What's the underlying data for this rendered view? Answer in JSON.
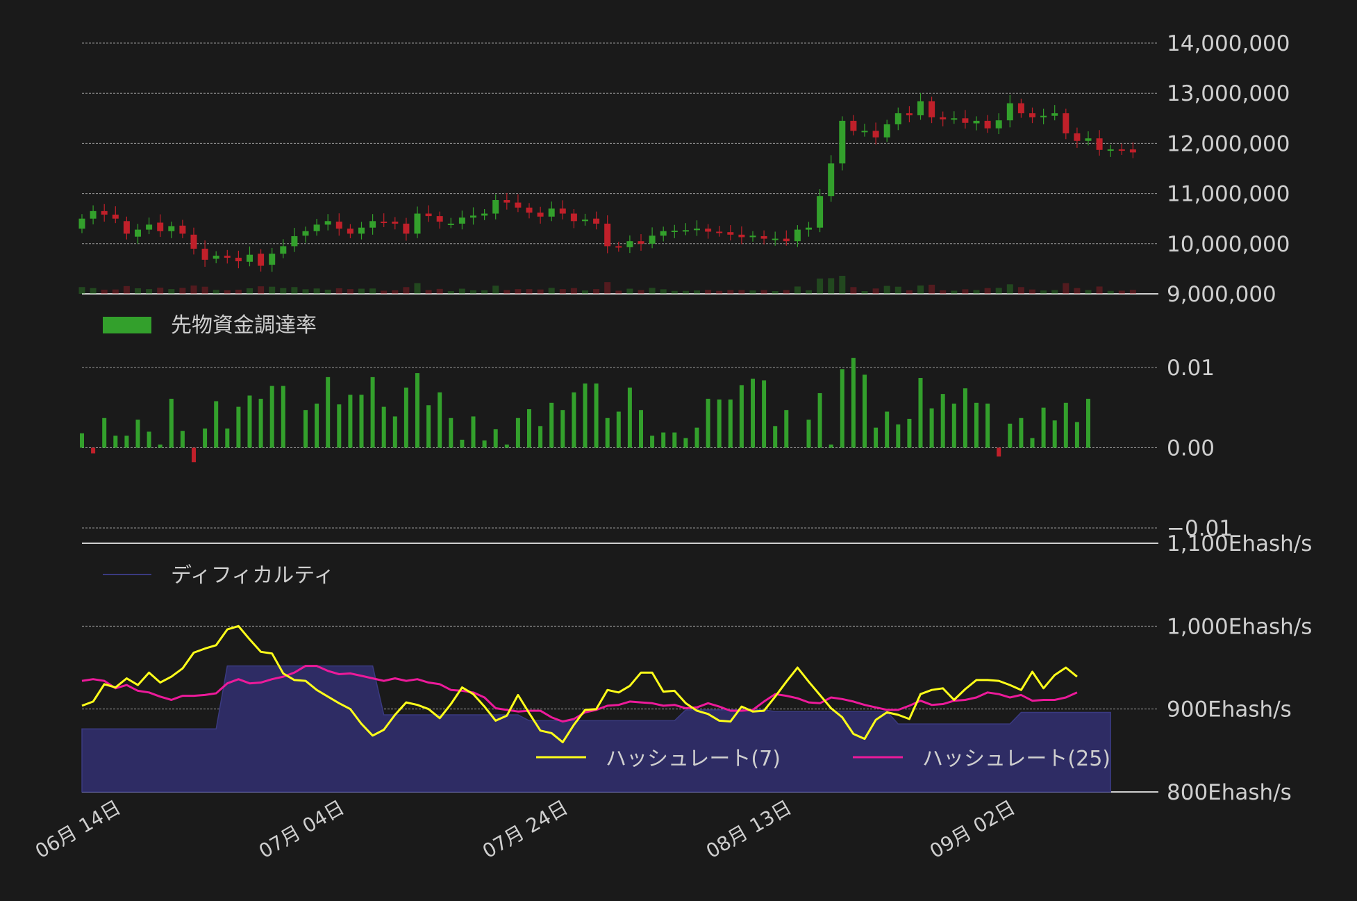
{
  "colors": {
    "background": "#1a1a1a",
    "up": "#33a02c",
    "down": "#c0202a",
    "funding_bar": "#33a02c",
    "difficulty_fill": "#2e2c64",
    "difficulty_line": "#3a3a80",
    "hashrate7": "#ffff1a",
    "hashrate25": "#ec1a9a",
    "axis_text": "#cfcfcf",
    "grid": "#9a9a9a"
  },
  "chart_data": [
    {
      "type": "candlestick",
      "panel": "price",
      "ylim": [
        9000000,
        14000000
      ],
      "y_ticks": [
        "14,000,000",
        "13,000,000",
        "12,000,000",
        "11,000,000",
        "10,000,000",
        "9,000,000"
      ],
      "y_tick_values": [
        14000000,
        13000000,
        12000000,
        11000000,
        10000000,
        9000000
      ],
      "x_tick_labels": [
        "06月 14日",
        "07月 04日",
        "07月 24日",
        "08月 13日",
        "09月 02日"
      ],
      "x_tick_index": [
        0,
        20,
        40,
        60,
        80
      ],
      "close": [
        10500000,
        10650000,
        10580000,
        10500000,
        10200000,
        10280000,
        10380000,
        10250000,
        10350000,
        10200000,
        9900000,
        9680000,
        9760000,
        9720000,
        9650000,
        9780000,
        9560000,
        9800000,
        9950000,
        10150000,
        10250000,
        10380000,
        10450000,
        10300000,
        10200000,
        10320000,
        10450000,
        10420000,
        10400000,
        10200000,
        10600000,
        10550000,
        10440000,
        10400000,
        10520000,
        10560000,
        10600000,
        10870000,
        10820000,
        10720000,
        10620000,
        10540000,
        10700000,
        10600000,
        10450000,
        10480000,
        10400000,
        9950000,
        9930000,
        10050000,
        10000000,
        10160000,
        10250000,
        10260000,
        10270000,
        10300000,
        10240000,
        10230000,
        10180000,
        10130000,
        10160000,
        10100000,
        10100000,
        10050000,
        10280000,
        10320000,
        10950000,
        11600000,
        12450000,
        12250000,
        12250000,
        12120000,
        12380000,
        12600000,
        12560000,
        12840000,
        12520000,
        12480000,
        12500000,
        12410000,
        12450000,
        12300000,
        12460000,
        12800000,
        12600000,
        12520000,
        12550000,
        12600000,
        12200000,
        12050000,
        12100000,
        11870000,
        11880000,
        11860000,
        11820000
      ],
      "open": [
        10300000,
        10500000,
        10650000,
        10580000,
        10450000,
        10140000,
        10280000,
        10420000,
        10250000,
        10360000,
        10180000,
        9900000,
        9700000,
        9760000,
        9720000,
        9640000,
        9800000,
        9580000,
        9800000,
        9950000,
        10160000,
        10250000,
        10380000,
        10440000,
        10300000,
        10200000,
        10320000,
        10440000,
        10440000,
        10400000,
        10200000,
        10600000,
        10550000,
        10400000,
        10400000,
        10520000,
        10560000,
        10600000,
        10870000,
        10820000,
        10720000,
        10620000,
        10540000,
        10700000,
        10600000,
        10450000,
        10500000,
        10400000,
        9950000,
        9930000,
        10050000,
        10000000,
        10160000,
        10250000,
        10260000,
        10270000,
        10300000,
        10240000,
        10230000,
        10180000,
        10130000,
        10150000,
        10100000,
        10100000,
        10050000,
        10280000,
        10320000,
        10950000,
        11600000,
        12450000,
        12250000,
        12250000,
        12120000,
        12380000,
        12600000,
        12560000,
        12840000,
        12520000,
        12480000,
        12500000,
        12400000,
        12450000,
        12300000,
        12460000,
        12800000,
        12600000,
        12520000,
        12550000,
        12600000,
        12200000,
        12050000,
        12100000,
        11870000,
        11880000,
        11880000
      ]
    },
    {
      "type": "bar",
      "panel": "funding",
      "series": [
        {
          "name": "先物資金調達率"
        }
      ],
      "ylim": [
        -0.01,
        0.01
      ],
      "y_ticks": [
        "0.01",
        "0.00",
        "−0.01"
      ],
      "y_tick_values": [
        0.01,
        0.0,
        -0.01
      ],
      "values": [
        0.0018,
        -0.0007,
        0.0037,
        0.0015,
        0.0015,
        0.0035,
        0.002,
        0.0004,
        0.0061,
        0.0021,
        -0.0018,
        0.0024,
        0.0058,
        0.0024,
        0.0051,
        0.0065,
        0.0061,
        0.0077,
        0.0077,
        null,
        0.0047,
        0.0055,
        0.0088,
        0.0054,
        0.0066,
        0.0066,
        0.0088,
        0.0051,
        0.0039,
        0.0075,
        0.0093,
        0.0053,
        0.0069,
        0.0037,
        0.001,
        0.0039,
        0.0009,
        0.0023,
        0.0004,
        0.0037,
        0.0048,
        0.0027,
        0.0056,
        0.0047,
        0.0069,
        0.008,
        0.008,
        0.0037,
        0.0045,
        0.0075,
        0.0047,
        0.0015,
        0.0019,
        0.0019,
        0.0012,
        0.0025,
        0.0061,
        0.006,
        0.006,
        0.0078,
        0.0086,
        0.0084,
        0.0027,
        0.0047,
        null,
        0.0035,
        0.0068,
        0.0004,
        0.0098,
        0.0112,
        0.0091,
        0.0025,
        0.0045,
        0.0029,
        0.0036,
        0.0087,
        0.0049,
        0.0067,
        0.0055,
        0.0074,
        0.0056,
        0.0055,
        -0.0011,
        0.003,
        0.0037,
        0.0012,
        0.005,
        0.0034,
        0.0056,
        0.0032,
        0.0061
      ]
    },
    {
      "type": "line",
      "panel": "hashrate",
      "ylim": [
        800,
        1100
      ],
      "y_ticks": [
        "1,100Ehash/s",
        "1,000Ehash/s",
        "900Ehash/s",
        "800Ehash/s"
      ],
      "y_tick_values": [
        1100,
        1000,
        900,
        800
      ],
      "series": [
        {
          "name": "ディフィカルティ",
          "type": "area",
          "values": [
            876,
            876,
            876,
            876,
            876,
            876,
            876,
            876,
            876,
            876,
            876,
            876,
            876,
            952,
            952,
            952,
            952,
            952,
            952,
            952,
            952,
            952,
            952,
            952,
            952,
            952,
            952,
            893,
            893,
            893,
            893,
            893,
            893,
            893,
            893,
            893,
            893,
            893,
            893,
            893,
            886,
            886,
            886,
            886,
            886,
            886,
            886,
            886,
            886,
            886,
            886,
            886,
            886,
            886,
            899,
            899,
            899,
            899,
            899,
            899,
            899,
            899,
            897,
            897,
            897,
            897,
            897,
            897,
            897,
            897,
            897,
            897,
            897,
            882,
            882,
            882,
            882,
            882,
            882,
            882,
            882,
            882,
            882,
            882,
            896,
            896,
            896,
            896,
            896,
            896,
            896,
            896,
            896
          ]
        },
        {
          "name": "ハッシュレート(7)",
          "values": [
            904,
            909,
            930,
            926,
            937,
            929,
            944,
            932,
            939,
            949,
            968,
            973,
            977,
            996,
            1000,
            984,
            969,
            967,
            943,
            935,
            934,
            923,
            915,
            907,
            900,
            882,
            868,
            875,
            893,
            908,
            905,
            900,
            889,
            906,
            926,
            918,
            903,
            886,
            892,
            917,
            895,
            874,
            871,
            860,
            881,
            899,
            900,
            923,
            920,
            928,
            944,
            944,
            921,
            922,
            907,
            898,
            894,
            886,
            885,
            903,
            897,
            898,
            915,
            933,
            950,
            933,
            917,
            901,
            890,
            870,
            864,
            887,
            896,
            893,
            888,
            918,
            923,
            925,
            911,
            924,
            935,
            935,
            934,
            929,
            923,
            945,
            925,
            941,
            950,
            939
          ]
        },
        {
          "name": "ハッシュレート(25)",
          "values": [
            934,
            936,
            934,
            925,
            929,
            922,
            920,
            915,
            911,
            916,
            916,
            917,
            919,
            931,
            936,
            931,
            932,
            936,
            939,
            944,
            952,
            952,
            946,
            942,
            943,
            940,
            937,
            934,
            937,
            934,
            936,
            932,
            930,
            923,
            922,
            920,
            914,
            901,
            899,
            897,
            898,
            898,
            890,
            885,
            888,
            896,
            899,
            904,
            905,
            909,
            908,
            907,
            904,
            905,
            901,
            902,
            907,
            903,
            898,
            898,
            899,
            909,
            918,
            916,
            913,
            908,
            907,
            914,
            912,
            909,
            905,
            902,
            899,
            899,
            904,
            910,
            905,
            906,
            910,
            911,
            914,
            920,
            918,
            914,
            917,
            910,
            911,
            911,
            914,
            920
          ]
        }
      ]
    }
  ]
}
